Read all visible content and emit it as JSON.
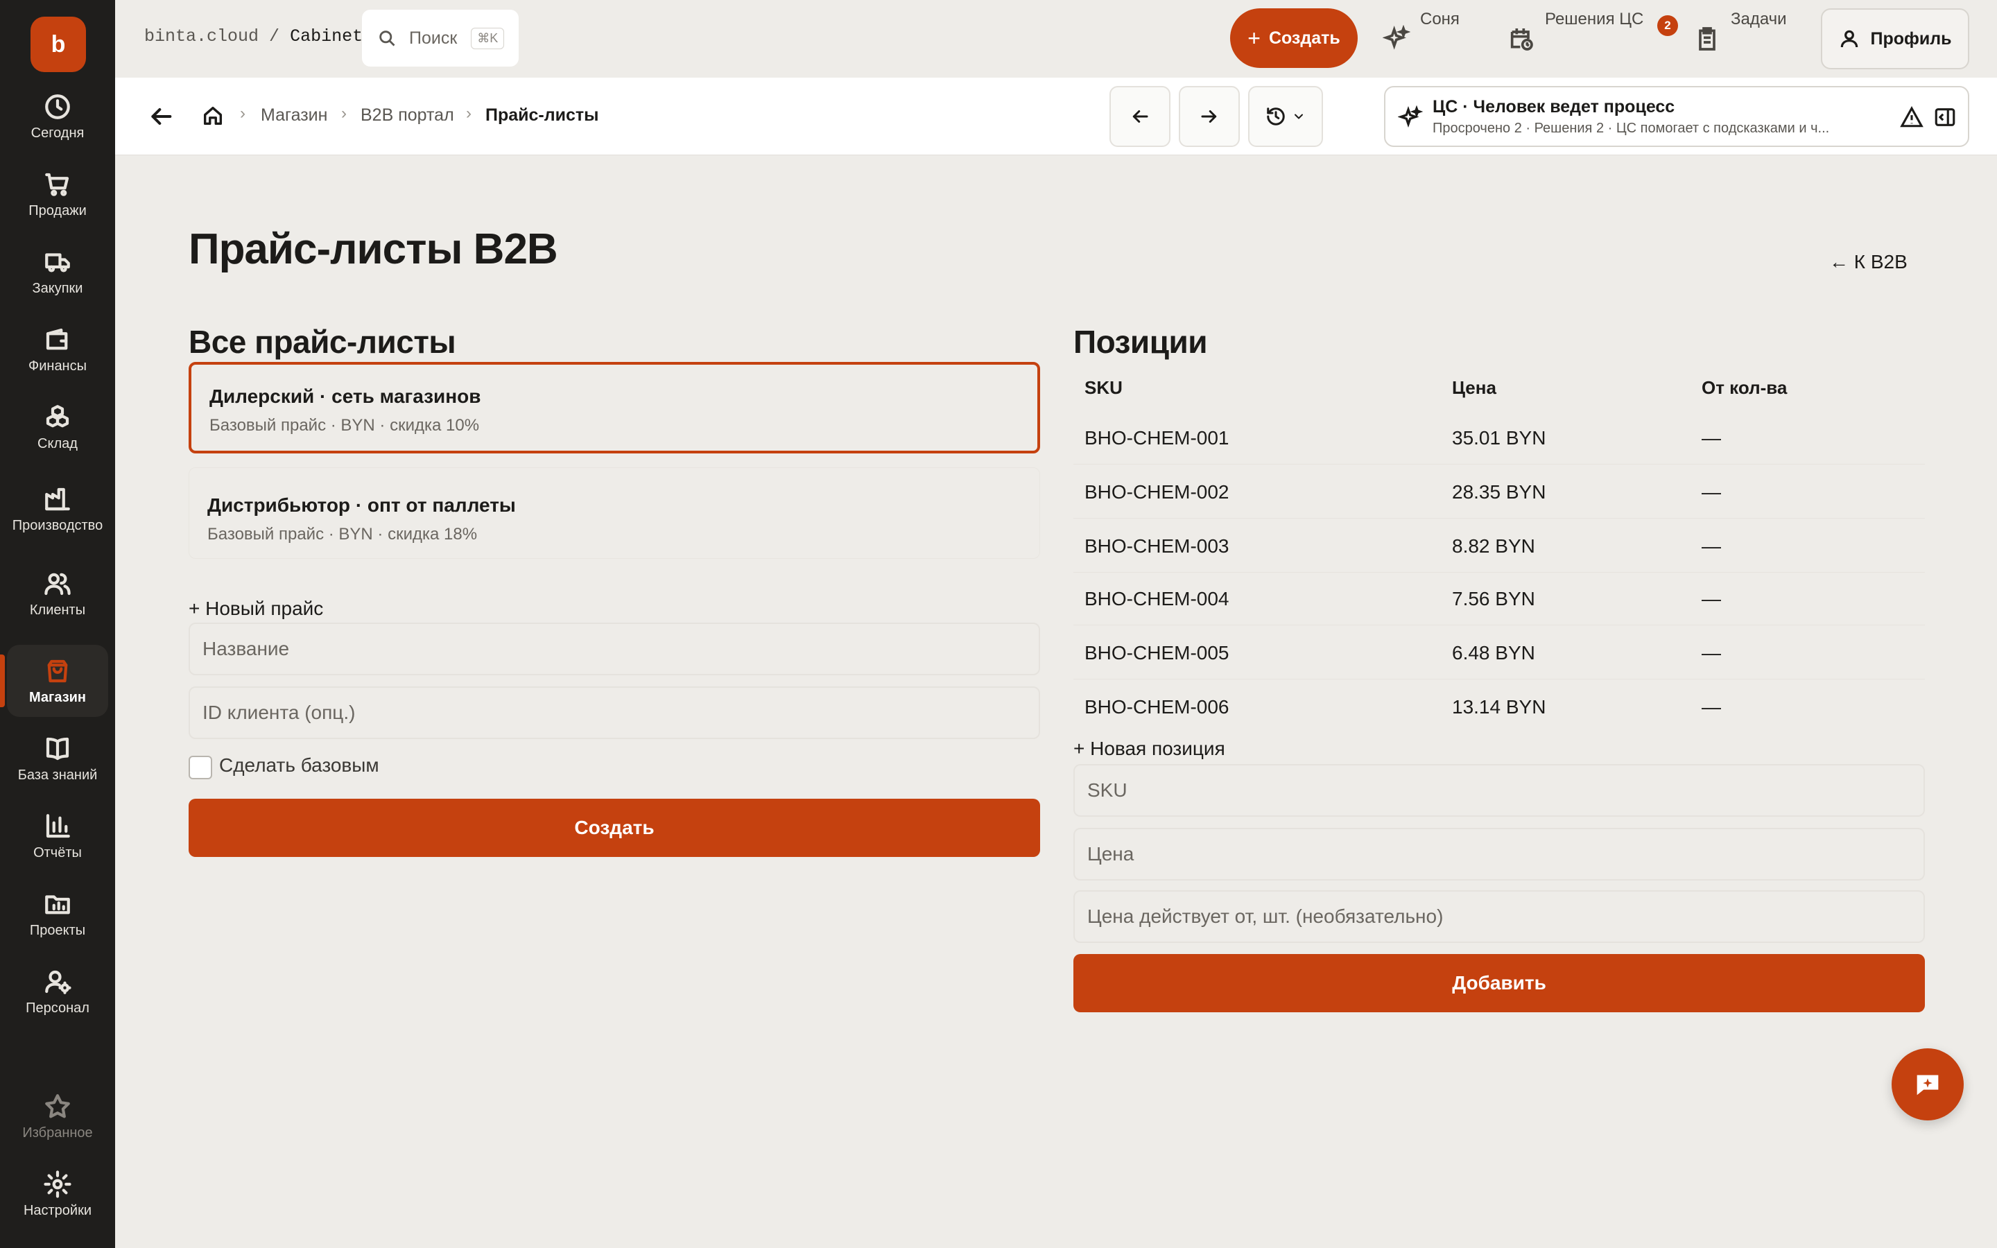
{
  "app": {
    "logo_letter": "b",
    "domain": "binta.cloud",
    "separator": "/",
    "workspace": "Cabinet"
  },
  "search": {
    "placeholder": "Поиск",
    "shortcut": "⌘K"
  },
  "header": {
    "create_label": "Создать",
    "tools": [
      {
        "label": "Соня",
        "icon": "sparkles-icon"
      },
      {
        "label": "Решения ЦС",
        "icon": "calendar-clock-icon",
        "badge": "2"
      },
      {
        "label": "Задачи",
        "icon": "clipboard-icon"
      }
    ],
    "profile_label": "Профиль"
  },
  "sidebar": {
    "items": [
      {
        "label": "Сегодня",
        "icon": "clock-icon"
      },
      {
        "label": "Продажи",
        "icon": "cart-icon"
      },
      {
        "label": "Закупки",
        "icon": "truck-icon"
      },
      {
        "label": "Финансы",
        "icon": "wallet-icon"
      },
      {
        "label": "Склад",
        "icon": "boxes-icon"
      },
      {
        "label": "Производство",
        "icon": "factory-icon"
      },
      {
        "label": "Клиенты",
        "icon": "users-icon"
      },
      {
        "label": "Магазин",
        "icon": "shopping-bag-icon",
        "active": true
      },
      {
        "label": "База знаний",
        "icon": "book-icon"
      },
      {
        "label": "Отчёты",
        "icon": "bar-chart-icon"
      },
      {
        "label": "Проекты",
        "icon": "folder-chart-icon"
      },
      {
        "label": "Персонал",
        "icon": "user-gear-icon"
      }
    ],
    "bottom": [
      {
        "label": "Избранное",
        "icon": "star-icon"
      },
      {
        "label": "Настройки",
        "icon": "gear-icon"
      }
    ]
  },
  "breadcrumb": {
    "items": [
      "Магазин",
      "B2B портал",
      "Прайс-листы"
    ]
  },
  "cs_panel": {
    "title": "ЦС · Человек ведет процесс",
    "subtitle": "Просрочено 2 · Решения 2 · ЦС помогает с подсказками и ч..."
  },
  "page": {
    "title": "Прайс-листы B2B",
    "back_link": "← К B2B"
  },
  "pricelists": {
    "title": "Все прайс-листы",
    "items": [
      {
        "name": "Дилерский · сеть магазинов",
        "meta": "Базовый прайс · BYN · скидка 10%",
        "selected": true
      },
      {
        "name": "Дистрибьютор · опт от паллеты",
        "meta": "Базовый прайс · BYN · скидка 18%",
        "selected": false
      }
    ],
    "new_label": "+ Новый прайс",
    "name_placeholder": "Название",
    "client_placeholder": "ID клиента (опц.)",
    "make_base_label": "Сделать базовым",
    "create_button": "Создать"
  },
  "positions": {
    "title": "Позиции",
    "columns": [
      "SKU",
      "Цена",
      "От кол-ва"
    ],
    "rows": [
      [
        "BHO-CHEM-001",
        "35.01 BYN",
        "—"
      ],
      [
        "BHO-CHEM-002",
        "28.35 BYN",
        "—"
      ],
      [
        "BHO-CHEM-003",
        "8.82 BYN",
        "—"
      ],
      [
        "BHO-CHEM-004",
        "7.56 BYN",
        "—"
      ],
      [
        "BHO-CHEM-005",
        "6.48 BYN",
        "—"
      ],
      [
        "BHO-CHEM-006",
        "13.14 BYN",
        "—"
      ]
    ],
    "new_label": "+ Новая позиция",
    "sku_placeholder": "SKU",
    "price_placeholder": "Цена",
    "minqty_placeholder": "Цена действует от, шт. (необязательно)",
    "add_button": "Добавить"
  },
  "colors": {
    "accent": "#c5410f",
    "sidebar": "#1f1e1c",
    "background": "#eeece8"
  }
}
